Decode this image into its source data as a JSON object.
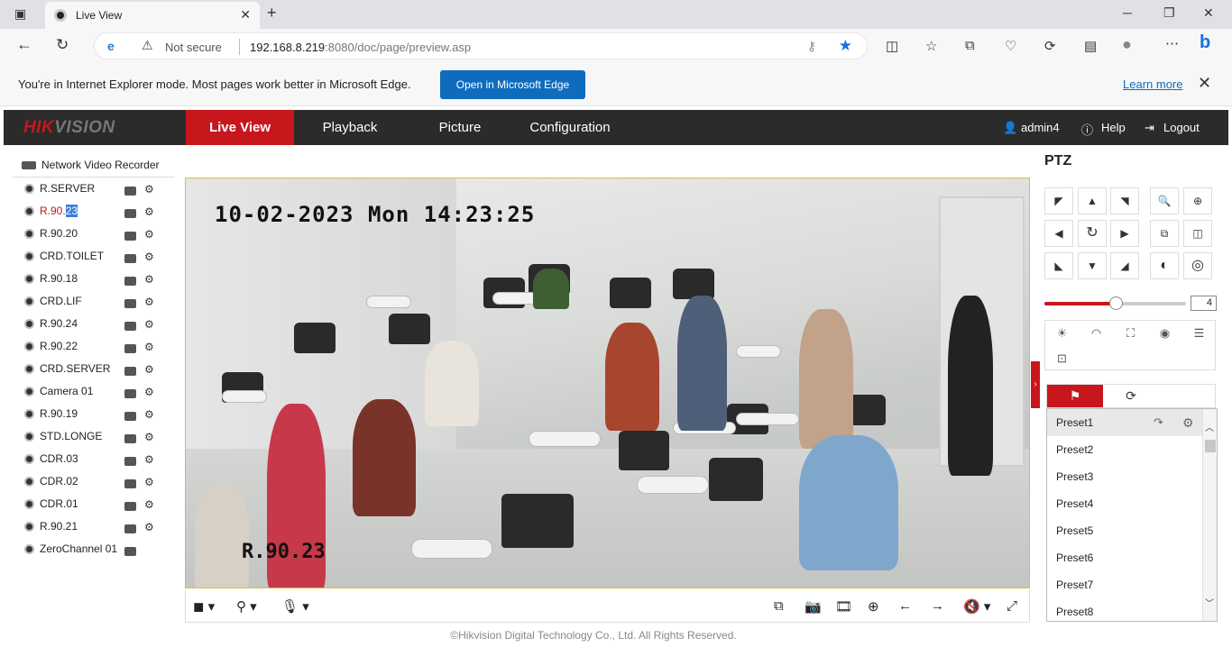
{
  "browser": {
    "tab_title": "Live View",
    "not_secure": "Not secure",
    "url_host": "192.168.8.219",
    "url_port": ":8080",
    "url_path": "/doc/page/preview.asp"
  },
  "ie_banner": {
    "message": "You're in Internet Explorer mode. Most pages work better in Microsoft Edge.",
    "open_button": "Open in Microsoft Edge",
    "learn_more": "Learn more"
  },
  "header": {
    "logo_main": "HIK",
    "logo_accent": "VISION",
    "tabs": [
      "Live View",
      "Playback",
      "Picture",
      "Configuration"
    ],
    "active_tab": "Live View",
    "user": "admin4",
    "help": "Help",
    "logout": "Logout"
  },
  "tree": {
    "root": "Network Video Recorder",
    "cameras": [
      {
        "name": "R.SERVER"
      },
      {
        "name": "R.90.",
        "highlight": "23",
        "active": true
      },
      {
        "name": "R.90.20"
      },
      {
        "name": "CRD.TOILET"
      },
      {
        "name": "R.90.18"
      },
      {
        "name": "CRD.LIF"
      },
      {
        "name": "R.90.24"
      },
      {
        "name": "R.90.22"
      },
      {
        "name": "CRD.SERVER"
      },
      {
        "name": "Camera 01"
      },
      {
        "name": "R.90.19"
      },
      {
        "name": "STD.LONGE"
      },
      {
        "name": "CDR.03"
      },
      {
        "name": "CDR.02"
      },
      {
        "name": "CDR.01"
      },
      {
        "name": "R.90.21"
      },
      {
        "name": "ZeroChannel 01"
      }
    ]
  },
  "video": {
    "osd_time": "10-02-2023 Mon 14:23:25",
    "osd_name": "R.90.23"
  },
  "footer": "©Hikvision Digital Technology Co., Ltd. All Rights Reserved.",
  "ptz": {
    "title": "PTZ",
    "speed": "4",
    "speed_fraction": 0.5,
    "presets": [
      "Preset1",
      "Preset2",
      "Preset3",
      "Preset4",
      "Preset5",
      "Preset6",
      "Preset7",
      "Preset8"
    ],
    "selected_preset": "Preset1"
  },
  "colors": {
    "accent": "#c8161d",
    "header_bg": "#2b2b2b",
    "edge_blue": "#0f6cbd"
  }
}
